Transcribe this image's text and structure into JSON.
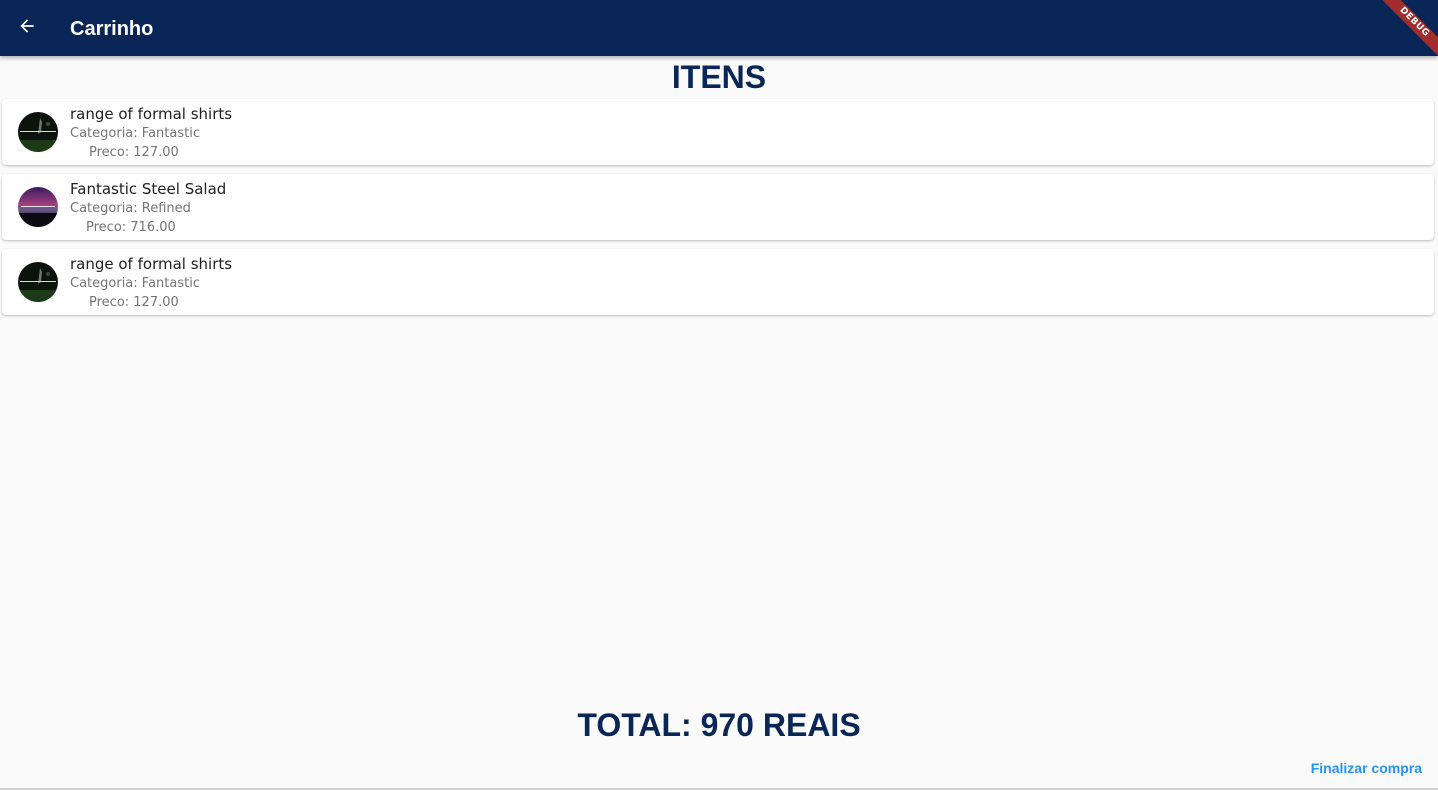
{
  "appbar": {
    "title": "Carrinho",
    "back_icon": "arrow-left-icon",
    "color": "#0a2657"
  },
  "debug_banner": "DEBUG",
  "section_title": "ITENS",
  "items": [
    {
      "name": "range of formal shirts",
      "category": "Categoria: Fantastic",
      "price": "Preco: 127.00",
      "thumbnail": "dark-green-image"
    },
    {
      "name": "Fantastic Steel Salad",
      "category": "Categoria: Refined",
      "price": "Preco: 716.00",
      "thumbnail": "purple-sky-image"
    },
    {
      "name": "range of formal shirts",
      "category": "Categoria: Fantastic",
      "price": "Preco: 127.00",
      "thumbnail": "dark-green-image"
    }
  ],
  "total": "TOTAL: 970 REAIS",
  "finish_button": "Finalizar compra",
  "colors": {
    "primary": "#0a2657",
    "accent": "#2196f3",
    "background": "#fafafa",
    "debug": "#a32c2c"
  }
}
